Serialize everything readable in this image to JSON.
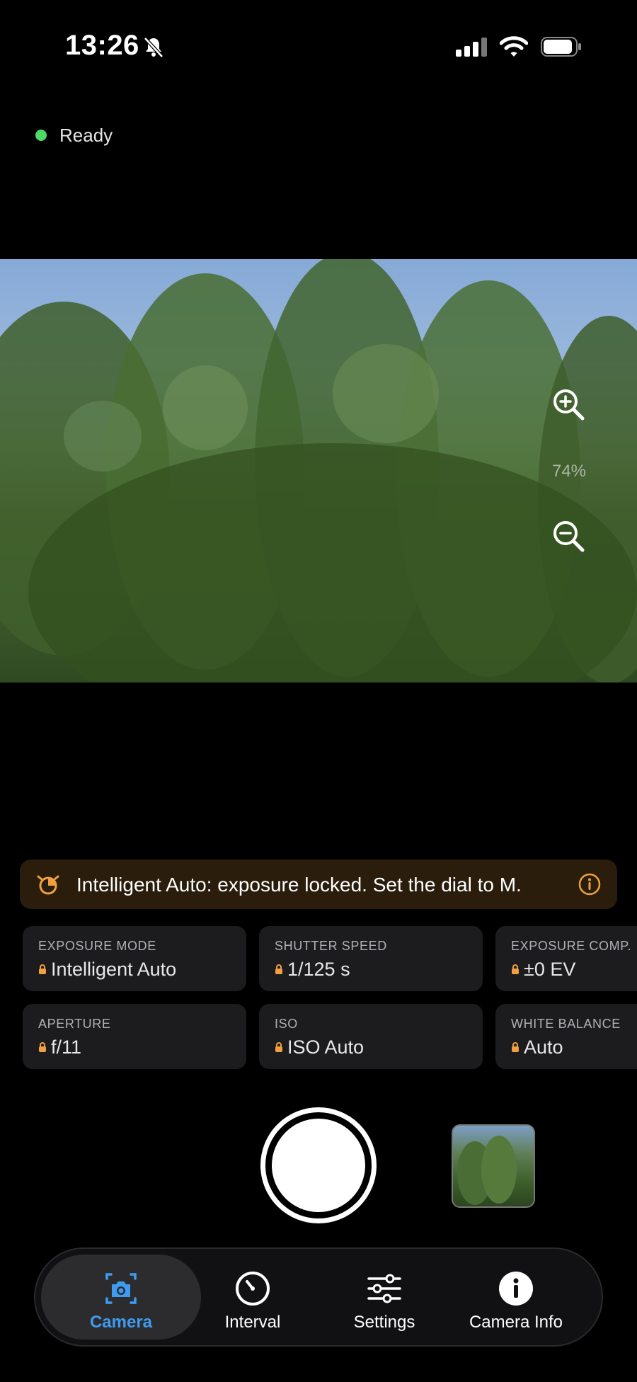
{
  "status_bar": {
    "time": "13:26"
  },
  "connection": {
    "label": "Ready",
    "color": "#4cd964"
  },
  "viewfinder": {
    "zoom_level": "74%"
  },
  "warning": {
    "text": "Intelligent Auto: exposure locked. Set the dial to M.",
    "accent": "#f0a040"
  },
  "settings": [
    {
      "label": "EXPOSURE MODE",
      "value": "Intelligent Auto",
      "locked": true
    },
    {
      "label": "SHUTTER SPEED",
      "value": "1/125 s",
      "locked": true
    },
    {
      "label": "EXPOSURE COMP.",
      "value": "±0 EV",
      "locked": true
    },
    {
      "label": "APERTURE",
      "value": "f/11",
      "locked": true
    },
    {
      "label": "ISO",
      "value": "ISO Auto",
      "locked": true
    },
    {
      "label": "WHITE BALANCE",
      "value": "Auto",
      "locked": true
    }
  ],
  "tabs": [
    {
      "label": "Camera",
      "icon": "camera-icon",
      "active": true
    },
    {
      "label": "Interval",
      "icon": "timer-icon",
      "active": false
    },
    {
      "label": "Settings",
      "icon": "sliders-icon",
      "active": false
    },
    {
      "label": "Camera Info",
      "icon": "info-icon",
      "active": false
    }
  ],
  "colors": {
    "accent_blue": "#3f9bf2",
    "lock_orange": "#f0a040",
    "ready_green": "#4cd964"
  }
}
